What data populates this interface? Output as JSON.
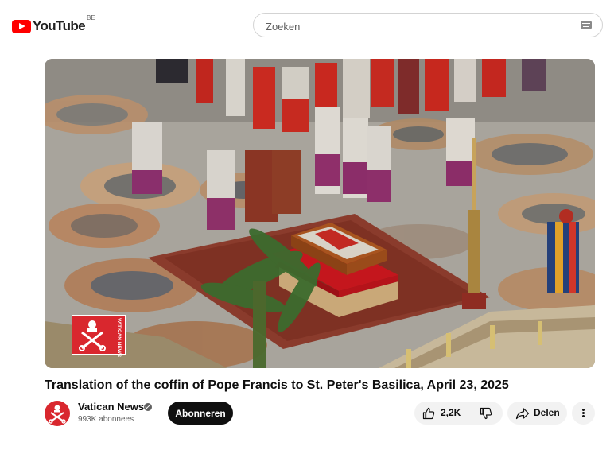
{
  "header": {
    "logo_text": "YouTube",
    "country_code": "BE",
    "search_placeholder": "Zoeken"
  },
  "video": {
    "title": "Translation of the coffin of Pope Francis to St. Peter's Basilica, April 23, 2025",
    "watermark_text": "VATICAN NEWS"
  },
  "channel": {
    "name": "Vatican News",
    "subscribers": "993K abonnees",
    "subscribe_label": "Abonneren"
  },
  "actions": {
    "like_count": "2,2K",
    "share_label": "Delen",
    "more_icon": "more-vert-icon"
  },
  "colors": {
    "brand_red": "#ff0000",
    "subscribe_bg": "#0f0f0f",
    "chip_bg": "#f2f2f2"
  }
}
